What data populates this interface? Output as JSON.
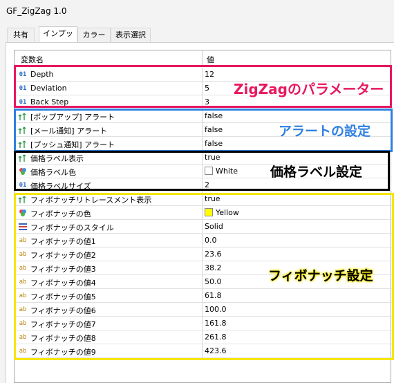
{
  "window": {
    "title": "GF_ZigZag 1.0"
  },
  "tabs": [
    {
      "label": "共有",
      "active": false
    },
    {
      "label": "インプット",
      "active": true
    },
    {
      "label": "カラー",
      "active": false
    },
    {
      "label": "表示選択",
      "active": false
    }
  ],
  "table": {
    "col_name": "変数名",
    "col_value": "値",
    "rows": [
      {
        "icon": "01",
        "name": "Depth",
        "value": "12"
      },
      {
        "icon": "01",
        "name": "Deviation",
        "value": "5"
      },
      {
        "icon": "01",
        "name": "Back Step",
        "value": "3"
      },
      {
        "icon": "bool",
        "name": "[ポップアップ] アラート",
        "value": "false"
      },
      {
        "icon": "bool",
        "name": "[メール通知] アラート",
        "value": "false"
      },
      {
        "icon": "bool",
        "name": "[プッシュ通知] アラート",
        "value": "false"
      },
      {
        "icon": "bool",
        "name": "価格ラベル表示",
        "value": "true"
      },
      {
        "icon": "color",
        "name": "価格ラベル色",
        "value": "White",
        "swatch": "#ffffff"
      },
      {
        "icon": "01",
        "name": "価格ラベルサイズ",
        "value": "2"
      },
      {
        "icon": "bool",
        "name": "フィボナッチリトレースメント表示",
        "value": "true"
      },
      {
        "icon": "color",
        "name": "フィボナッチの色",
        "value": "Yellow",
        "swatch": "#ffff00"
      },
      {
        "icon": "style",
        "name": "フィボナッチのスタイル",
        "value": "Solid"
      },
      {
        "icon": "ab",
        "name": "フィボナッチの値1",
        "value": "0.0"
      },
      {
        "icon": "ab",
        "name": "フィボナッチの値2",
        "value": "23.6"
      },
      {
        "icon": "ab",
        "name": "フィボナッチの値3",
        "value": "38.2"
      },
      {
        "icon": "ab",
        "name": "フィボナッチの値4",
        "value": "50.0"
      },
      {
        "icon": "ab",
        "name": "フィボナッチの値5",
        "value": "61.8"
      },
      {
        "icon": "ab",
        "name": "フィボナッチの値6",
        "value": "100.0"
      },
      {
        "icon": "ab",
        "name": "フィボナッチの値7",
        "value": "161.8"
      },
      {
        "icon": "ab",
        "name": "フィボナッチの値8",
        "value": "261.8"
      },
      {
        "icon": "ab",
        "name": "フィボナッチの値9",
        "value": "423.6"
      }
    ]
  },
  "annotations": [
    {
      "label": "ZigZagのパラメーター",
      "color": "#e8185f"
    },
    {
      "label": "アラートの設定",
      "color": "#2f7fe0"
    },
    {
      "label": "価格ラベル設定",
      "color": "#000000"
    },
    {
      "label": "フィボナッチ設定",
      "color": "#f5e600"
    }
  ]
}
